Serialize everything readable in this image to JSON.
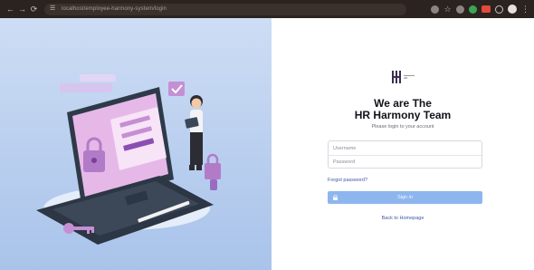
{
  "browser": {
    "url": "localhost/employee-harmony-system/login",
    "icons": [
      "back-icon",
      "forward-icon",
      "reload-icon",
      "site-info-icon",
      "zoom-icon",
      "bookmark-star-icon",
      "extension-icon",
      "extension-icon",
      "extension-icon",
      "extension-icon",
      "profile-avatar",
      "menu-icon"
    ]
  },
  "brand": {
    "logo_text": "HR",
    "primary_color": "#8eb6ee",
    "link_color": "#3e57a8"
  },
  "login": {
    "title_line1": "We are The",
    "title_line2": "HR Harmony Team",
    "subtitle": "Please login to your account",
    "username_placeholder": "Username",
    "password_placeholder": "Password",
    "forgot_label": "Forgot password?",
    "signin_label": "Sign in",
    "back_label": "Back to Homepage"
  },
  "hero": {
    "illustration": "secure-login-laptop",
    "colors": {
      "sky": "#b9cfef",
      "laptop": "#2f3a49",
      "screen_pink": "#e6b8e8",
      "accent_purple": "#9b6bc2"
    }
  }
}
